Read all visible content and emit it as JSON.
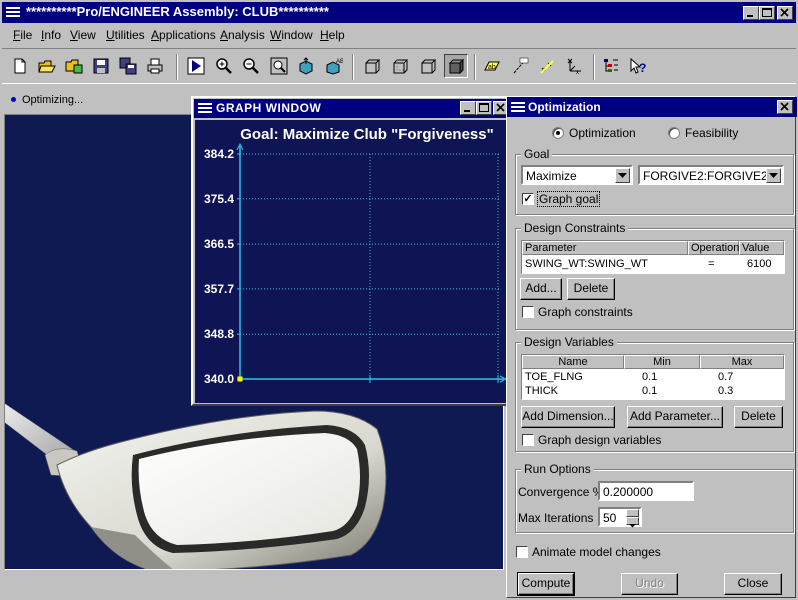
{
  "window": {
    "title": "**********Pro/ENGINEER Assembly: CLUB**********"
  },
  "menu": {
    "items": [
      {
        "key": "F",
        "rest": "ile"
      },
      {
        "key": "I",
        "rest": "nfo"
      },
      {
        "key": "V",
        "rest": "iew"
      },
      {
        "key": "U",
        "rest": "tilities"
      },
      {
        "key": "A",
        "rest": "pplications"
      },
      {
        "key": "A",
        "rest": "nalysis"
      },
      {
        "key": "W",
        "rest": "indow"
      },
      {
        "key": "H",
        "rest": "elp"
      }
    ]
  },
  "status": {
    "message": "Optimizing..."
  },
  "graph_window": {
    "title": "GRAPH WINDOW",
    "chart_data": {
      "type": "line",
      "title": "Goal: Maximize Club \"Forgiveness\"",
      "yticks": [
        "384.2",
        "375.4",
        "366.5",
        "357.7",
        "348.8",
        "340.0"
      ],
      "ylim": [
        340.0,
        384.2
      ],
      "grid": true,
      "series": [
        {
          "x": [
            0
          ],
          "y": [
            340.0
          ]
        }
      ]
    }
  },
  "optimization": {
    "title": "Optimization",
    "mode_options": {
      "optimization": "Optimization",
      "feasibility": "Feasibility"
    },
    "goal": {
      "group_label": "Goal",
      "type": "Maximize",
      "parameter": "FORGIVE2:FORGIVE2",
      "graph_goal_label": "Graph goal",
      "graph_goal_checked": true
    },
    "design_constraints": {
      "group_label": "Design Constraints",
      "columns": [
        "Parameter",
        "Operation",
        "Value"
      ],
      "rows": [
        {
          "parameter": "SWING_WT:SWING_WT",
          "operation": "=",
          "value": "6100"
        }
      ],
      "add_label": "Add...",
      "delete_label": "Delete",
      "graph_label": "Graph constraints"
    },
    "design_variables": {
      "group_label": "Design Variables",
      "columns": [
        "Name",
        "Min",
        "Max"
      ],
      "rows": [
        {
          "name": "TOE_FLNG",
          "min": "0.1",
          "max": "0.7"
        },
        {
          "name": "THICK",
          "min": "0.1",
          "max": "0.3"
        }
      ],
      "add_dimension_label": "Add Dimension...",
      "add_parameter_label": "Add Parameter...",
      "delete_label": "Delete",
      "graph_label": "Graph design variables"
    },
    "run_options": {
      "group_label": "Run Options",
      "convergence_label": "Convergence %",
      "convergence_value": "0.200000",
      "max_iterations_label": "Max Iterations",
      "max_iterations_value": "50"
    },
    "animate_label": "Animate model changes",
    "buttons": {
      "compute": "Compute",
      "undo": "Undo",
      "close": "Close"
    }
  },
  "colors": {
    "title_bar": "#000080",
    "graphics_bg": "#0f1a52",
    "graph_bg": "#0e1454",
    "grid_line": "#2fc6e8",
    "marker": "#ffff00"
  }
}
